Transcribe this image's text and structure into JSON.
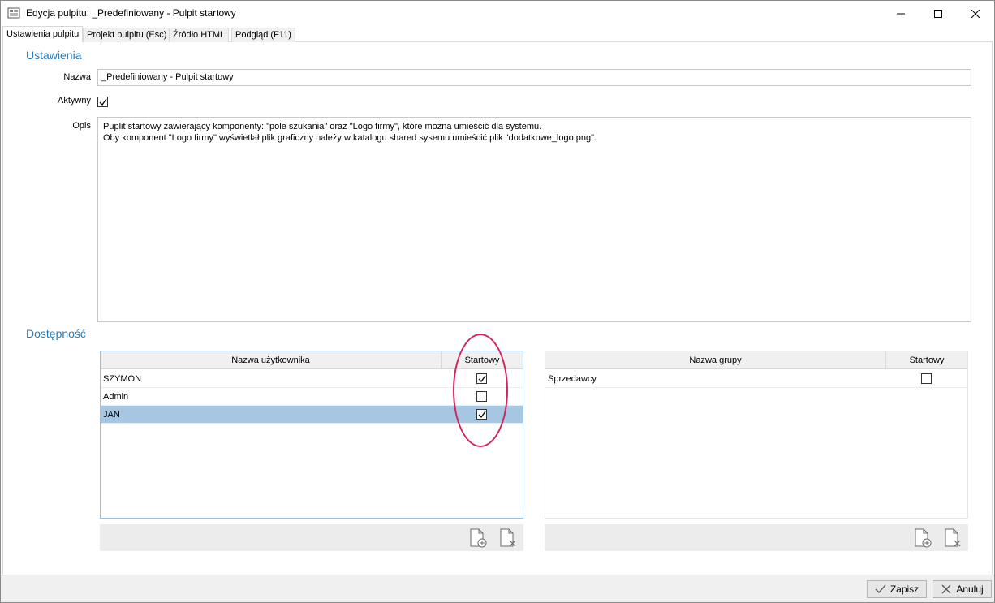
{
  "window": {
    "title": "Edycja pulpitu: _Predefiniowany - Pulpit startowy",
    "app_icon": "dashboard-edit-icon",
    "controls": [
      "minimize-icon",
      "maximize-icon",
      "close-icon"
    ]
  },
  "tabs": [
    {
      "label": "Ustawienia pulpitu",
      "active": true
    },
    {
      "label": "Projekt pulpitu (Esc)",
      "active": false
    },
    {
      "label": "Źródło HTML",
      "active": false
    },
    {
      "label": "Podgląd (F11)",
      "active": false
    }
  ],
  "settings": {
    "section_title": "Ustawienia",
    "name_label": "Nazwa",
    "name_value": "_Predefiniowany - Pulpit startowy",
    "active_label": "Aktywny",
    "active_checked": true,
    "description_label": "Opis",
    "description_lines": [
      "Puplit startowy zawierający komponenty: \"pole szukania\" oraz \"Logo firmy\", które można umieścić dla systemu.",
      "Oby komponent \"Logo firmy\" wyświetlał plik graficzny należy w katalogu shared sysemu umieścić plik \"dodatkowe_logo.png\"."
    ]
  },
  "availability": {
    "section_title": "Dostępność",
    "users_table": {
      "columns": [
        "Nazwa użytkownika",
        "Startowy"
      ],
      "rows": [
        {
          "name": "SZYMON",
          "startowy": true,
          "selected": false
        },
        {
          "name": "Admin",
          "startowy": false,
          "selected": false
        },
        {
          "name": "JAN",
          "startowy": true,
          "selected": true
        }
      ],
      "toolbar_icons": [
        "add-document-icon",
        "remove-document-icon"
      ]
    },
    "groups_table": {
      "columns": [
        "Nazwa grupy",
        "Startowy"
      ],
      "rows": [
        {
          "name": "Sprzedawcy",
          "startowy": false,
          "selected": false
        }
      ],
      "toolbar_icons": [
        "add-document-icon",
        "remove-document-icon"
      ]
    },
    "highlight_color": "#d0245a",
    "selection_color": "#a7c6e2"
  },
  "footer": {
    "save_label": "Zapisz",
    "cancel_label": "Anuluj"
  },
  "colors": {
    "section_title": "#2a7ab8"
  }
}
